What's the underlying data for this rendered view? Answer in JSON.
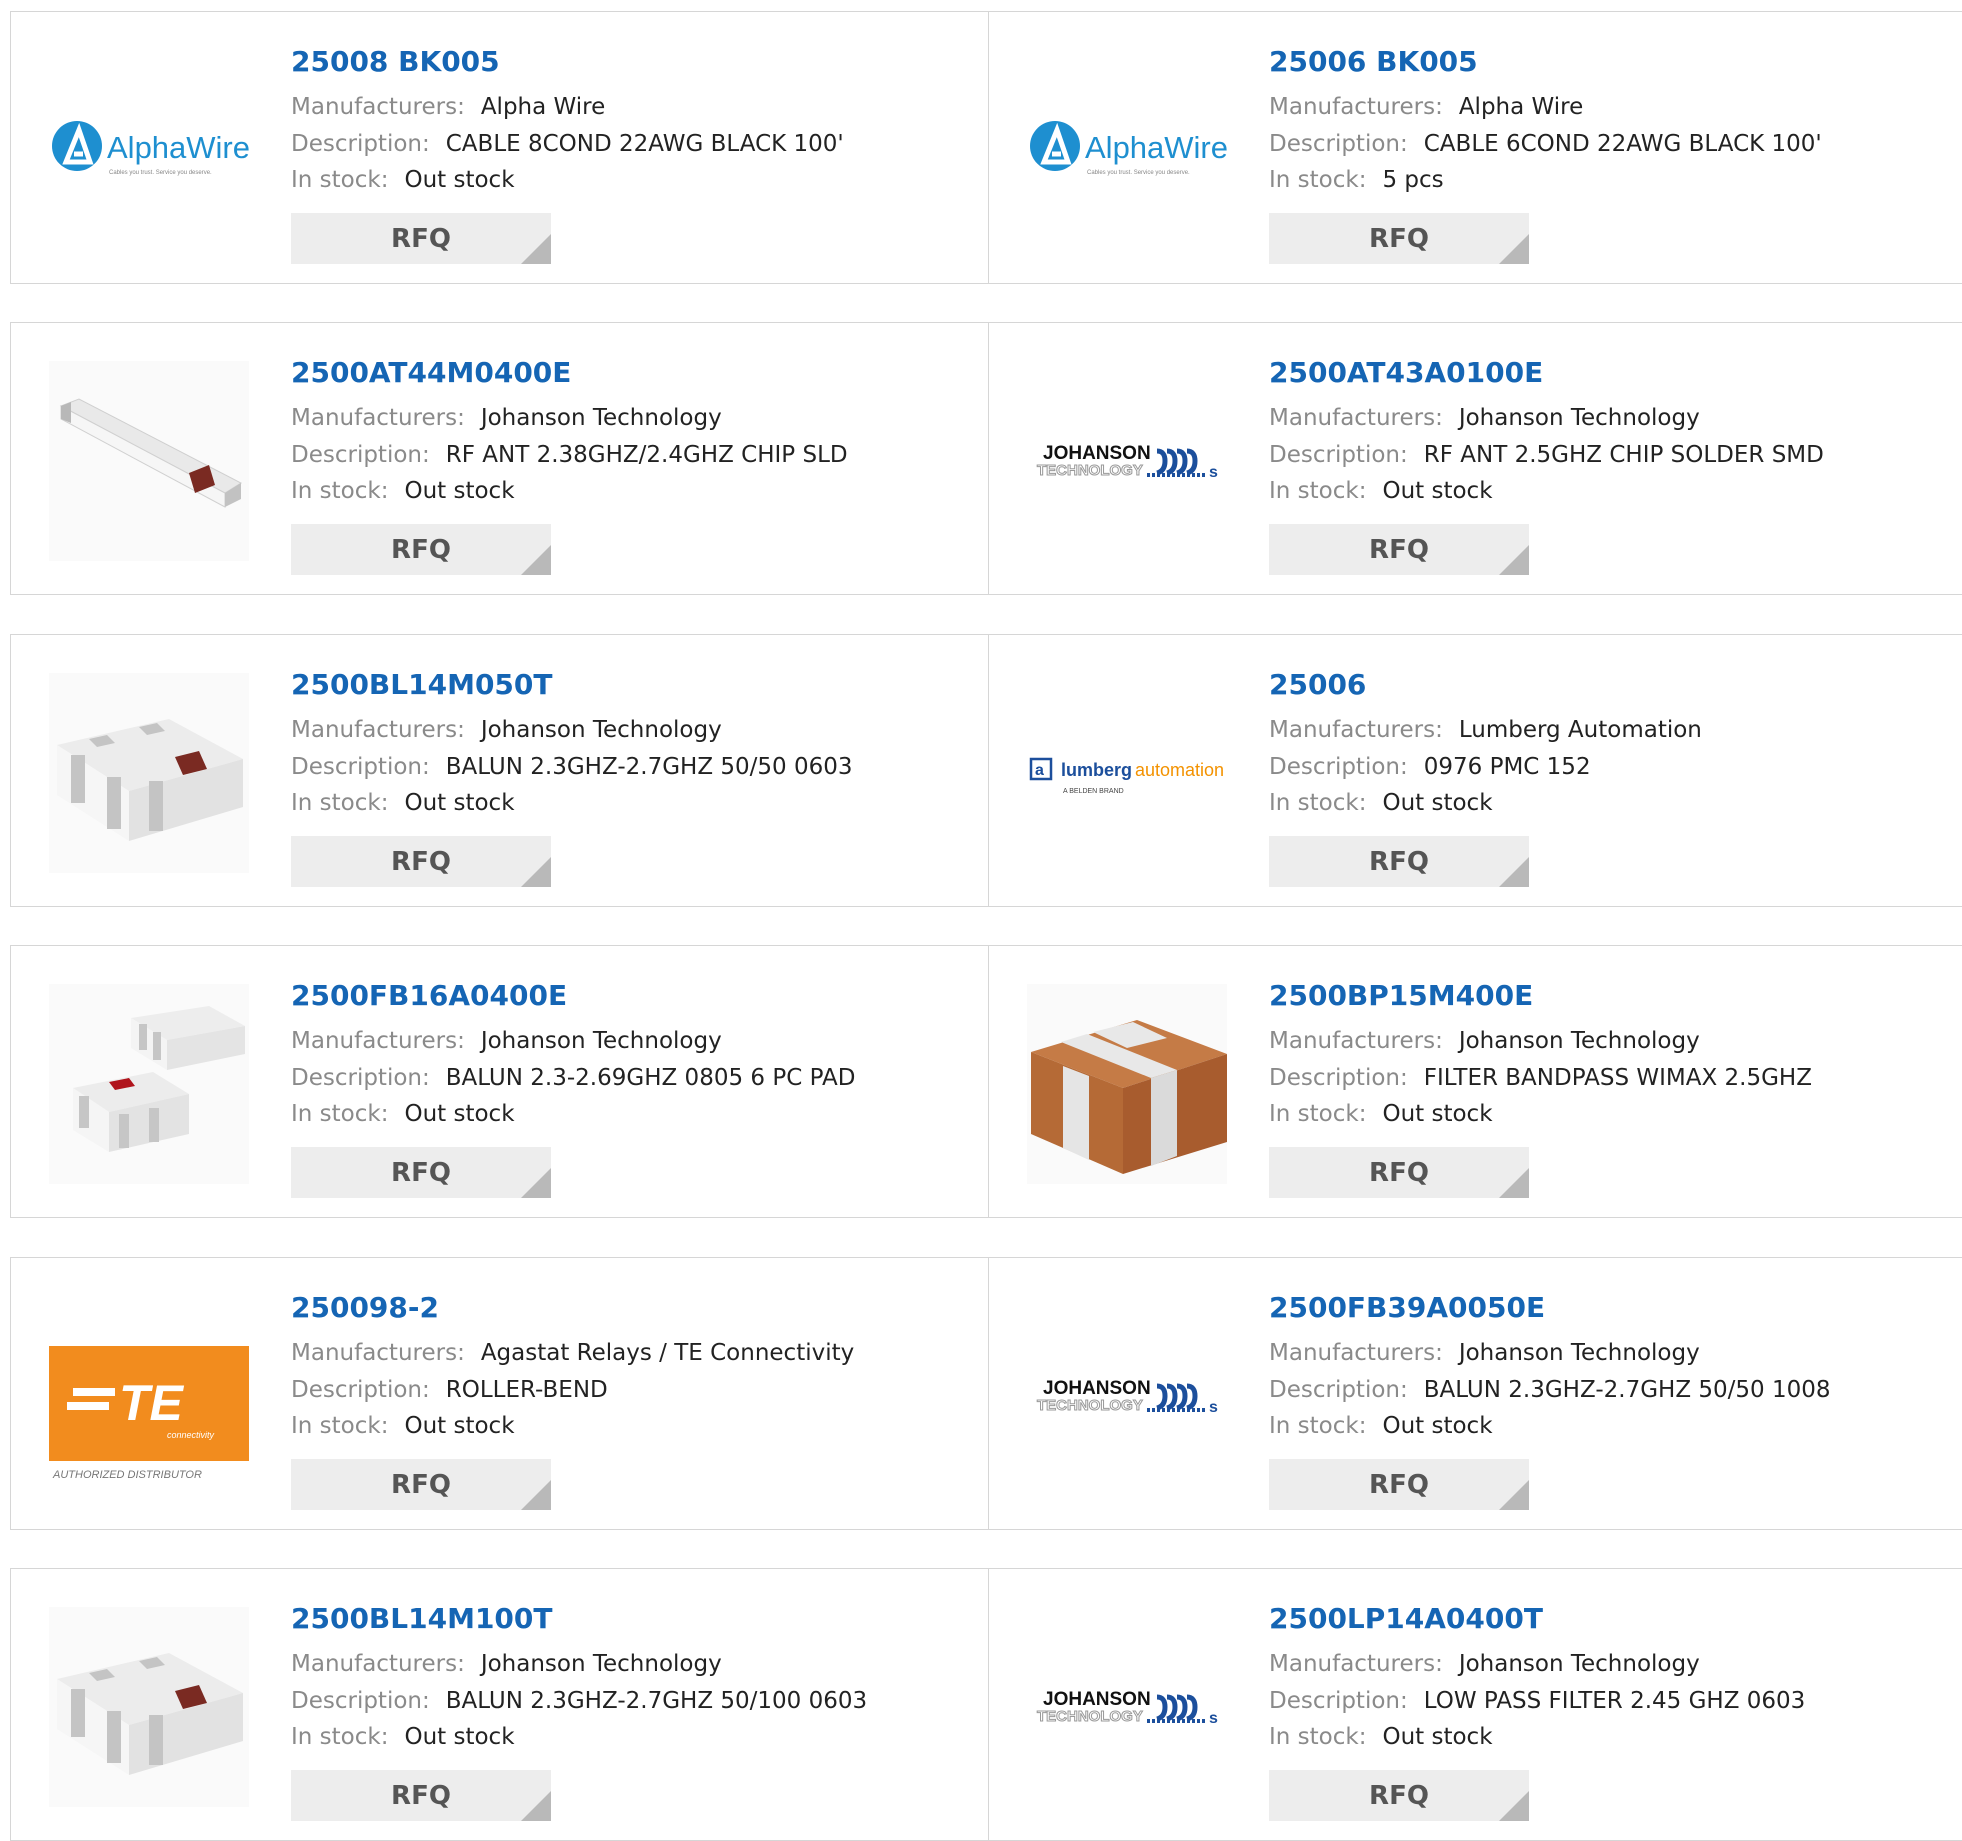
{
  "labels": {
    "manufacturers": "Manufacturers:",
    "description": "Description:",
    "in_stock": "In stock:",
    "rfq": "RFQ"
  },
  "logos": {
    "alphawire": {
      "name": "AlphaWire",
      "tagline": "Cables you trust. Service you deserve."
    },
    "johanson": {
      "line1": "JOHANSON",
      "line2": "TECHNOLOGY"
    },
    "lumberg": {
      "name_a": "lumberg",
      "name_b": "automation",
      "sub": "A BELDEN BRAND"
    },
    "te": {
      "name": "TE",
      "sub": "connectivity",
      "authorized": "AUTHORIZED DISTRIBUTOR"
    }
  },
  "colors": {
    "link": "#1565b4",
    "alphawire_blue": "#1e8fd0",
    "te_orange": "#f28c1e",
    "lumberg_blue": "#1c4f9c",
    "lumberg_orange": "#f39200"
  },
  "products": [
    {
      "part": "25008 BK005",
      "manufacturer": "Alpha Wire",
      "description": "CABLE 8COND 22AWG BLACK 100'",
      "stock": "Out stock",
      "image": "alphawire-logo"
    },
    {
      "part": "25006 BK005",
      "manufacturer": "Alpha Wire",
      "description": "CABLE 6COND 22AWG BLACK 100'",
      "stock": "5 pcs",
      "image": "alphawire-logo"
    },
    {
      "part": "2500AT44M0400E",
      "manufacturer": "Johanson Technology",
      "description": "RF ANT 2.38GHZ/2.4GHZ CHIP SLD",
      "stock": "Out stock",
      "image": "chip-antenna-photo"
    },
    {
      "part": "2500AT43A0100E",
      "manufacturer": "Johanson Technology",
      "description": "RF ANT 2.5GHZ CHIP SOLDER SMD",
      "stock": "Out stock",
      "image": "johanson-logo"
    },
    {
      "part": "2500BL14M050T",
      "manufacturer": "Johanson Technology",
      "description": "BALUN 2.3GHZ-2.7GHZ 50/50 0603",
      "stock": "Out stock",
      "image": "balun-chip-photo"
    },
    {
      "part": "25006",
      "manufacturer": "Lumberg Automation",
      "description": "0976 PMC 152",
      "stock": "Out stock",
      "image": "lumberg-logo"
    },
    {
      "part": "2500FB16A0400E",
      "manufacturer": "Johanson Technology",
      "description": "BALUN 2.3-2.69GHZ 0805 6 PC PAD",
      "stock": "Out stock",
      "image": "balun-pair-photo"
    },
    {
      "part": "2500BP15M400E",
      "manufacturer": "Johanson Technology",
      "description": "FILTER BANDPASS WIMAX 2.5GHZ",
      "stock": "Out stock",
      "image": "bandpass-filter-photo"
    },
    {
      "part": "250098-2",
      "manufacturer": "Agastat Relays / TE Connectivity",
      "description": "ROLLER-BEND",
      "stock": "Out stock",
      "image": "te-logo"
    },
    {
      "part": "2500FB39A0050E",
      "manufacturer": "Johanson Technology",
      "description": "BALUN 2.3GHZ-2.7GHZ 50/50 1008",
      "stock": "Out stock",
      "image": "johanson-logo"
    },
    {
      "part": "2500BL14M100T",
      "manufacturer": "Johanson Technology",
      "description": "BALUN 2.3GHZ-2.7GHZ 50/100 0603",
      "stock": "Out stock",
      "image": "balun-chip-photo"
    },
    {
      "part": "2500LP14A0400T",
      "manufacturer": "Johanson Technology",
      "description": "LOW PASS FILTER 2.45 GHZ 0603",
      "stock": "Out stock",
      "image": "johanson-logo"
    }
  ]
}
